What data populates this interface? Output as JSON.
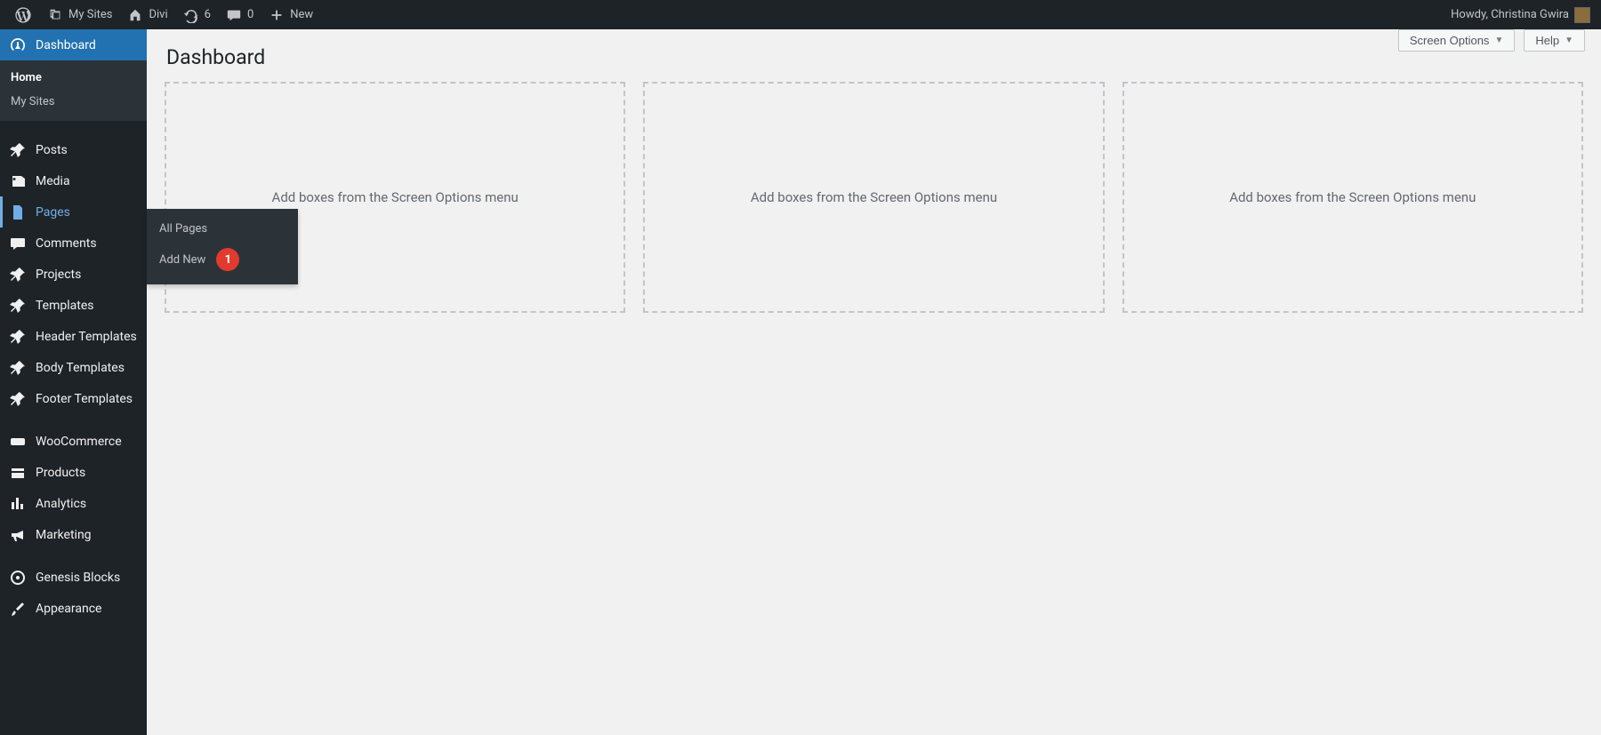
{
  "adminbar": {
    "my_sites": "My Sites",
    "site_name": "Divi",
    "updates_count": "6",
    "comments_count": "0",
    "new_label": "New",
    "howdy": "Howdy, Christina Gwira"
  },
  "sidebar": {
    "dashboard": "Dashboard",
    "dashboard_sub": {
      "home": "Home",
      "my_sites": "My Sites"
    },
    "posts": "Posts",
    "media": "Media",
    "pages": "Pages",
    "pages_sub": {
      "all": "All Pages",
      "add_new": "Add New"
    },
    "comments": "Comments",
    "projects": "Projects",
    "templates": "Templates",
    "header_templates": "Header Templates",
    "body_templates": "Body Templates",
    "footer_templates": "Footer Templates",
    "woocommerce": "WooCommerce",
    "products": "Products",
    "analytics": "Analytics",
    "marketing": "Marketing",
    "genesis_blocks": "Genesis Blocks",
    "appearance": "Appearance"
  },
  "controls": {
    "screen_options": "Screen Options",
    "help": "Help"
  },
  "page": {
    "title": "Dashboard",
    "empty_widget": "Add boxes from the Screen Options menu"
  },
  "annotation": {
    "step1": "1"
  }
}
